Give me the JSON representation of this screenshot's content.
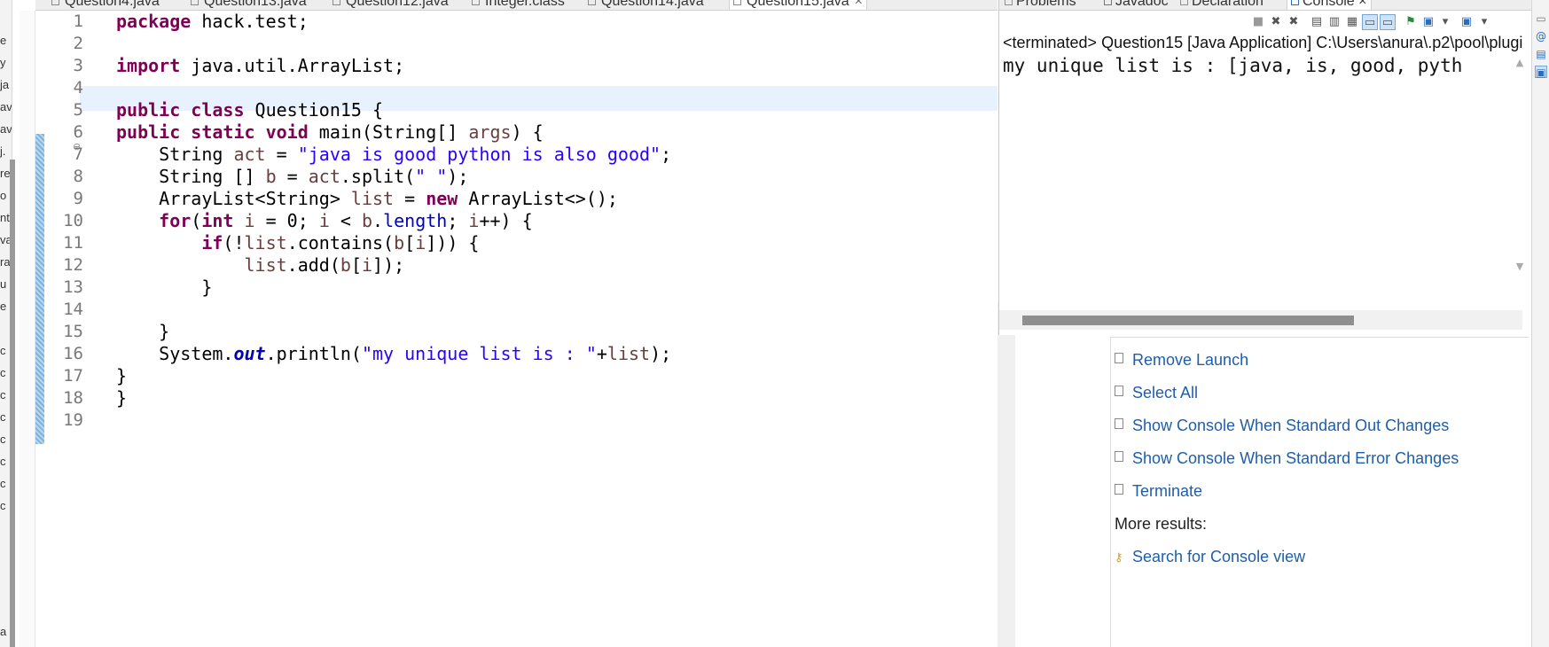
{
  "left_panel": {
    "fragments": [
      "e",
      "y",
      "ja",
      "av",
      "av",
      "j.",
      "re",
      "o",
      "nt",
      "va",
      "ra",
      "u",
      "e",
      "c",
      "c",
      "c",
      "c",
      "c",
      "c",
      "c",
      "c",
      "a"
    ]
  },
  "editor_tabs": [
    {
      "label": "Question4.java",
      "active": false
    },
    {
      "label": "Question13.java",
      "active": false
    },
    {
      "label": "Question12.java",
      "active": false
    },
    {
      "label": "Integer.class",
      "active": false
    },
    {
      "label": "Question14.java",
      "active": false
    },
    {
      "label": "Question15.java",
      "active": true,
      "close": "×"
    }
  ],
  "editor": {
    "line_numbers": [
      "1",
      "2",
      "3",
      "4",
      "5",
      "6",
      "7",
      "8",
      "9",
      "10",
      "11",
      "12",
      "13",
      "14",
      "15",
      "16",
      "17",
      "18",
      "19"
    ],
    "fold_marker": "⊖",
    "code": {
      "l1_kw": "package",
      "l1_rest": " hack.test;",
      "l3_kw": "import",
      "l3_rest": " java.util.ArrayList;",
      "l5_kw1": "public",
      "l5_kw2": " class",
      "l5_rest": " Question15 {",
      "l6_kw1": "public",
      "l6_kw2": " static",
      "l6_kw3": " void",
      "l6_rest1": " main(String[] ",
      "l6_var": "args",
      "l6_rest2": ") {",
      "l7_pre": "    String ",
      "l7_var": "act",
      "l7_mid": " = ",
      "l7_str": "\"java is good python is also good\"",
      "l7_end": ";",
      "l8_pre": "    String [] ",
      "l8_var1": "b",
      "l8_mid": " = ",
      "l8_var2": "act",
      "l8_mid2": ".split(",
      "l8_str": "\" \"",
      "l8_end": ");",
      "l9_pre": "    ArrayList<String> ",
      "l9_var": "list",
      "l9_mid": " = ",
      "l9_kw": "new",
      "l9_end": " ArrayList<>();",
      "l10_pre": "    ",
      "l10_kw1": "for",
      "l10_p1": "(",
      "l10_kw2": "int",
      "l10_v1": " i",
      "l10_p2": " = 0; ",
      "l10_v2": "i",
      "l10_p3": " < ",
      "l10_v3": "b",
      "l10_p4": ".",
      "l10_fld": "length",
      "l10_p5": "; ",
      "l10_v4": "i",
      "l10_p6": "++) {",
      "l11_pre": "        ",
      "l11_kw": "if",
      "l11_p1": "(!",
      "l11_v1": "list",
      "l11_p2": ".contains(",
      "l11_v2": "b",
      "l11_p3": "[",
      "l11_v3": "i",
      "l11_p4": "])) {",
      "l12_pre": "            ",
      "l12_v1": "list",
      "l12_p1": ".add(",
      "l12_v2": "b",
      "l12_p2": "[",
      "l12_v3": "i",
      "l12_p3": "]);",
      "l13": "        }",
      "l15": "    }",
      "l16_pre": "    System.",
      "l16_sf": "out",
      "l16_p1": ".println(",
      "l16_str": "\"my unique list is : \"",
      "l16_p2": "+",
      "l16_v": "list",
      "l16_p3": ");",
      "l17": "}",
      "l18": "}"
    }
  },
  "console": {
    "tabs": [
      {
        "label": "Problems",
        "active": false
      },
      {
        "label": "Javadoc",
        "active": false
      },
      {
        "label": "Declaration",
        "active": false
      },
      {
        "label": "Console",
        "active": true,
        "close": "×"
      }
    ],
    "toolbar_icons": [
      "terminate-icon",
      "remove-launch-icon",
      "remove-all-icon",
      "clear-console-icon",
      "scroll-lock-icon",
      "word-wrap-icon",
      "show-on-stdout-icon",
      "show-on-stderr-icon",
      "pin-console-icon",
      "display-selected-console-icon",
      "dropdown-arrow",
      "open-console-icon",
      "dropdown-arrow"
    ],
    "status": "<terminated> Question15 [Java Application] C:\\Users\\anura\\.p2\\pool\\plugi",
    "output": "my unique list is : [java, is, good, pyth"
  },
  "search_results": {
    "items": [
      {
        "label": "Remove Launch"
      },
      {
        "label": "Select All"
      },
      {
        "label": "Show Console When Standard Out Changes"
      },
      {
        "label": "Show Console When Standard Error Changes"
      },
      {
        "label": "Terminate"
      }
    ],
    "more_label": "More results:",
    "search_link": "Search for Console view"
  },
  "right_strip": {
    "icons": [
      "minimize-icon",
      "javadoc-at-icon",
      "declaration-icon",
      "console-icon"
    ]
  }
}
